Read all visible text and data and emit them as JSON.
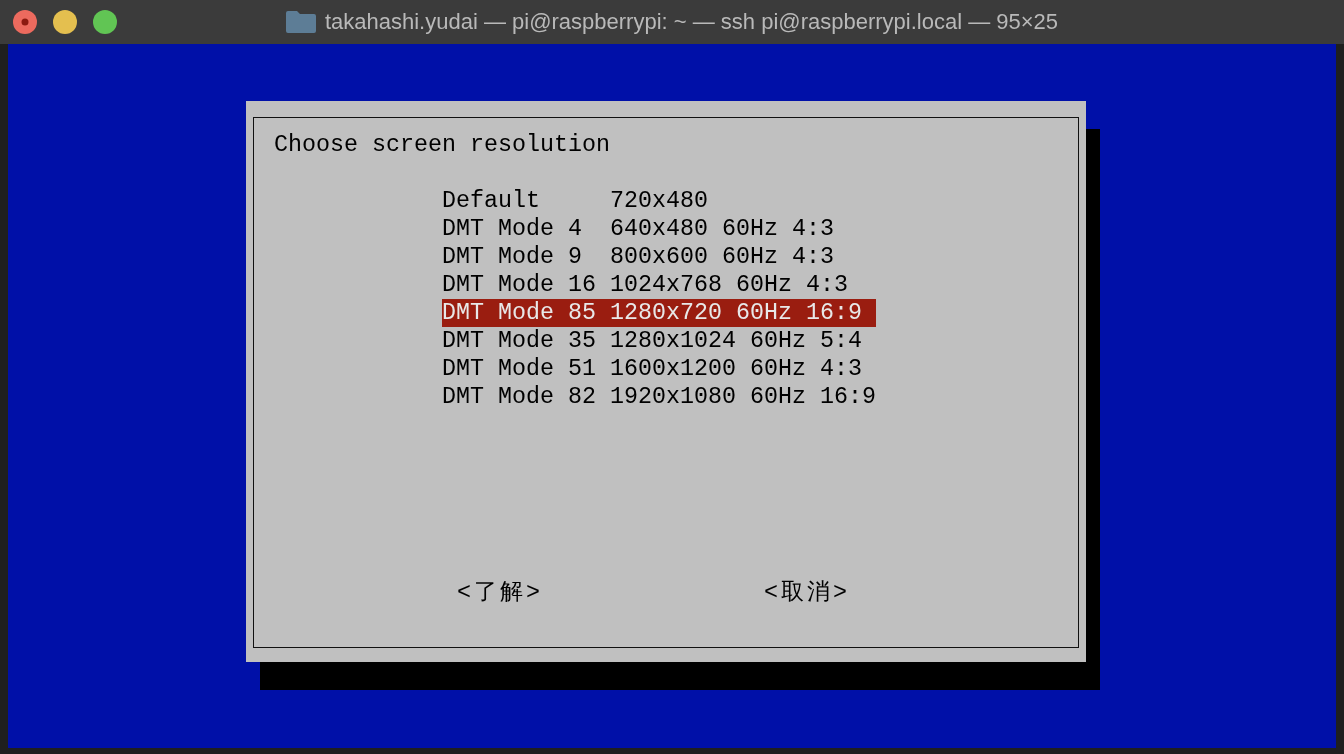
{
  "window": {
    "title": "takahashi.yudai — pi@raspberrypi: ~ — ssh pi@raspberrypi.local — 95×25"
  },
  "dialog": {
    "title": "Choose screen resolution",
    "items": [
      {
        "name": "Default",
        "description": "720x480",
        "selected": false
      },
      {
        "name": "DMT Mode 4",
        "description": "640x480 60Hz 4:3",
        "selected": false
      },
      {
        "name": "DMT Mode 9",
        "description": "800x600 60Hz 4:3",
        "selected": false
      },
      {
        "name": "DMT Mode 16",
        "description": "1024x768 60Hz 4:3",
        "selected": false
      },
      {
        "name": "DMT Mode 85",
        "description": "1280x720 60Hz 16:9",
        "selected": true
      },
      {
        "name": "DMT Mode 35",
        "description": "1280x1024 60Hz 5:4",
        "selected": false
      },
      {
        "name": "DMT Mode 51",
        "description": "1600x1200 60Hz 4:3",
        "selected": false
      },
      {
        "name": "DMT Mode 82",
        "description": "1920x1080 60Hz 16:9",
        "selected": false
      }
    ],
    "buttons": [
      "<了解>",
      "<取消>"
    ]
  }
}
